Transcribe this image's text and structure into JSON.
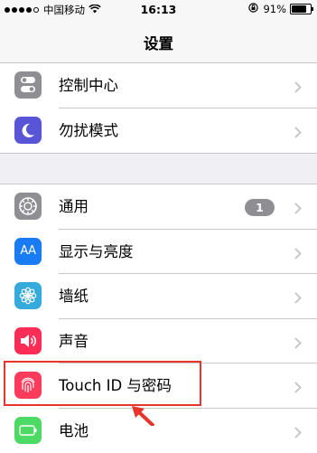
{
  "status_bar": {
    "carrier": "中国移动",
    "time": "16:13",
    "battery_percent": "91%",
    "battery_level": 0.91
  },
  "nav": {
    "title": "设置"
  },
  "groups": [
    {
      "items": [
        {
          "label": "控制中心",
          "icon": "control-center-icon",
          "color": "#8e8e93"
        },
        {
          "label": "勿扰模式",
          "icon": "moon-icon",
          "color": "#5856d6"
        }
      ]
    },
    {
      "items": [
        {
          "label": "通用",
          "icon": "gear-icon",
          "color": "#8e8e93",
          "badge": "1"
        },
        {
          "label": "显示与亮度",
          "icon": "display-icon",
          "color": "#1a7cf5",
          "icon_text": "AA"
        },
        {
          "label": "墙纸",
          "icon": "flower-icon",
          "color": "#35aadc"
        },
        {
          "label": "声音",
          "icon": "speaker-icon",
          "color": "#ff2d55"
        },
        {
          "label": "Touch ID 与密码",
          "icon": "fingerprint-icon",
          "color": "#ff3b5c"
        },
        {
          "label": "电池",
          "icon": "battery-icon",
          "color": "#4cd964"
        }
      ]
    }
  ],
  "highlight_color": "#e8352b"
}
